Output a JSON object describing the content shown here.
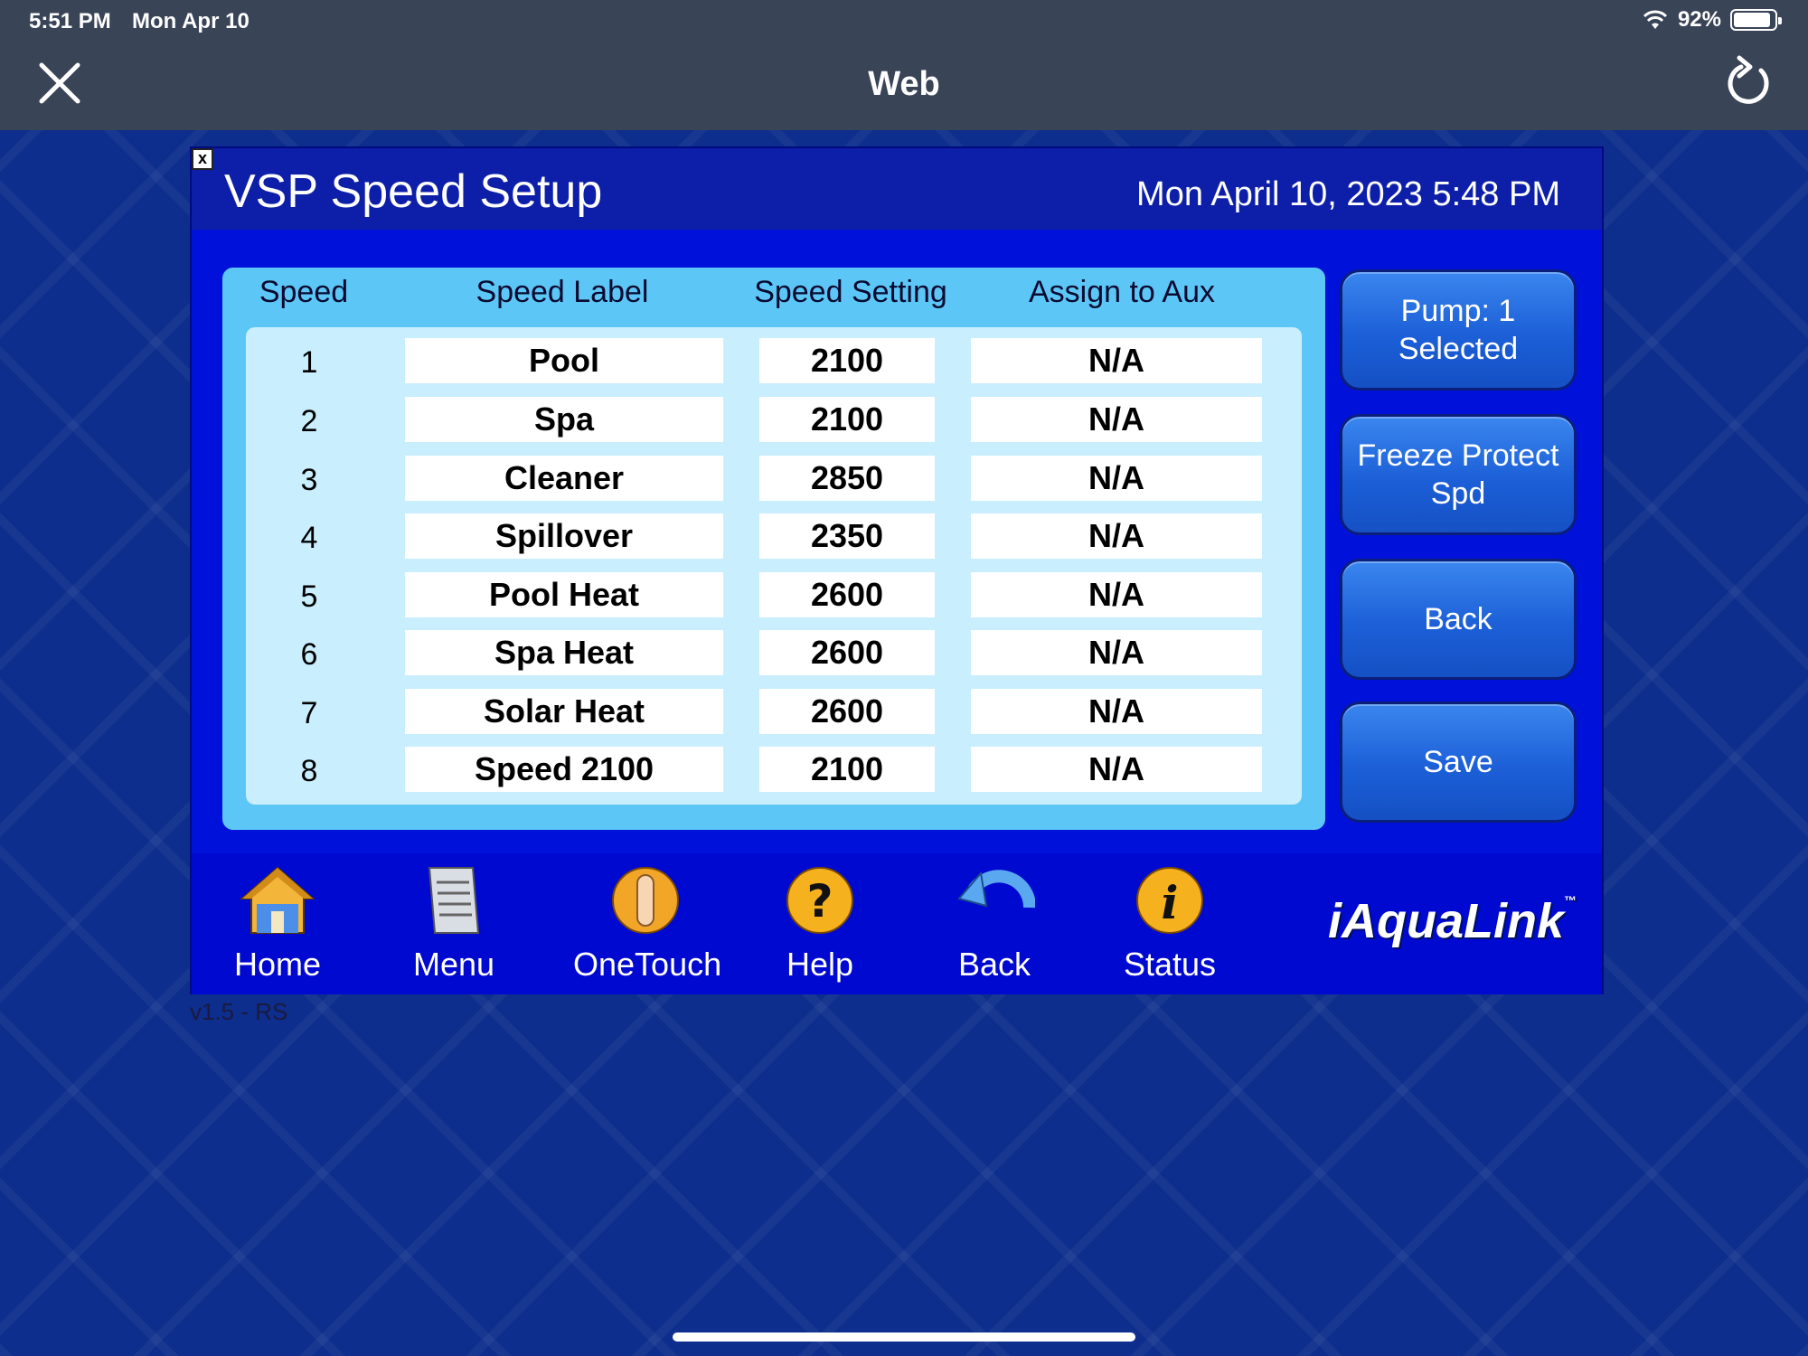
{
  "status_bar": {
    "time": "5:51 PM",
    "date": "Mon Apr 10",
    "battery": "92%",
    "battery_level": 0.92
  },
  "browser": {
    "title": "Web"
  },
  "app": {
    "title": "VSP Speed Setup",
    "datetime": "Mon April 10, 2023 5:48 PM",
    "close_label": "x",
    "columns": [
      "Speed",
      "Speed Label",
      "Speed Setting",
      "Assign to Aux"
    ],
    "rows": [
      {
        "speed": "1",
        "label": "Pool",
        "setting": "2100",
        "aux": "N/A"
      },
      {
        "speed": "2",
        "label": "Spa",
        "setting": "2100",
        "aux": "N/A"
      },
      {
        "speed": "3",
        "label": "Cleaner",
        "setting": "2850",
        "aux": "N/A"
      },
      {
        "speed": "4",
        "label": "Spillover",
        "setting": "2350",
        "aux": "N/A"
      },
      {
        "speed": "5",
        "label": "Pool Heat",
        "setting": "2600",
        "aux": "N/A"
      },
      {
        "speed": "6",
        "label": "Spa Heat",
        "setting": "2600",
        "aux": "N/A"
      },
      {
        "speed": "7",
        "label": "Solar Heat",
        "setting": "2600",
        "aux": "N/A"
      },
      {
        "speed": "8",
        "label": "Speed 2100",
        "setting": "2100",
        "aux": "N/A"
      }
    ],
    "side_buttons": {
      "pump_line1": "Pump: 1",
      "pump_line2": "Selected",
      "freeze_line1": "Freeze Protect",
      "freeze_line2": "Spd",
      "back": "Back",
      "save": "Save"
    },
    "nav": {
      "home": "Home",
      "menu": "Menu",
      "onetouch": "OneTouch",
      "help": "Help",
      "back": "Back",
      "status": "Status"
    },
    "brand": "iAquaLink",
    "brand_tm": "™",
    "version": "v1.5 - RS"
  },
  "colors": {
    "background": "#0d2e8c",
    "panel": "#0012d9",
    "table_outer": "#5cc7f7",
    "table_inner": "#c9efff",
    "button": "#1c5fd7",
    "topbar": "#3a4457"
  }
}
